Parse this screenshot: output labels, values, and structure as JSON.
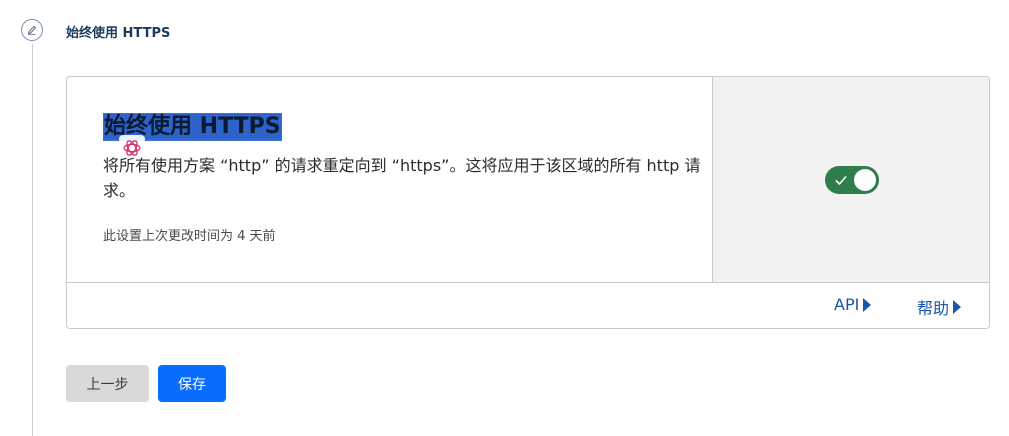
{
  "step": {
    "icon": "pencil-icon",
    "title": "始终使用 HTTPS"
  },
  "setting": {
    "title": "始终使用 HTTPS",
    "description": "将所有使用方案 “http” 的请求重定向到 “https”。这将应用于该区域的所有 http 请求。",
    "last_changed": "此设置上次更改时间为 4 天前",
    "enabled": true
  },
  "links": {
    "api": "API",
    "help": "帮助"
  },
  "buttons": {
    "prev": "上一步",
    "save": "保存"
  },
  "colors": {
    "toggle_on": "#2f7d4c",
    "link": "#1a56a8",
    "primary": "#0a6cff",
    "title_highlight": "#2e63c9"
  }
}
